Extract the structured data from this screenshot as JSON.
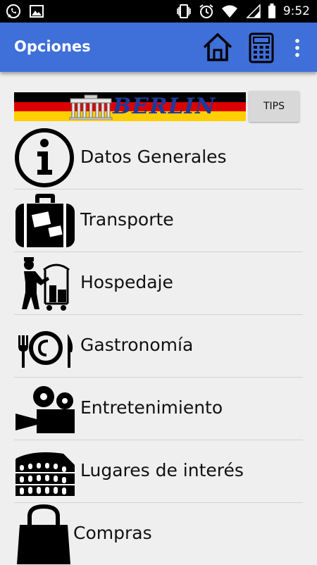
{
  "status_bar": {
    "time": "9:52"
  },
  "app_bar": {
    "title": "Opciones",
    "icons": [
      "home-icon",
      "calculator-icon",
      "more-vert-icon"
    ]
  },
  "banner": {
    "text": "BERLIN",
    "flag_colors": [
      "#000000",
      "#dd0000",
      "#ffce00"
    ]
  },
  "tips_button": {
    "label": "TIPS"
  },
  "menu": {
    "items": [
      {
        "label": "Datos Generales",
        "icon": "info-icon"
      },
      {
        "label": "Transporte",
        "icon": "suitcase-icon"
      },
      {
        "label": "Hospedaje",
        "icon": "bellhop-icon"
      },
      {
        "label": "Gastronomía",
        "icon": "dining-icon"
      },
      {
        "label": "Entretenimiento",
        "icon": "movie-camera-icon"
      },
      {
        "label": "Lugares de interés",
        "icon": "colosseum-icon"
      },
      {
        "label": "Compras",
        "icon": "shopping-bag-icon"
      }
    ]
  },
  "colors": {
    "app_bar": "#3f6fd8",
    "background": "#efefef"
  }
}
